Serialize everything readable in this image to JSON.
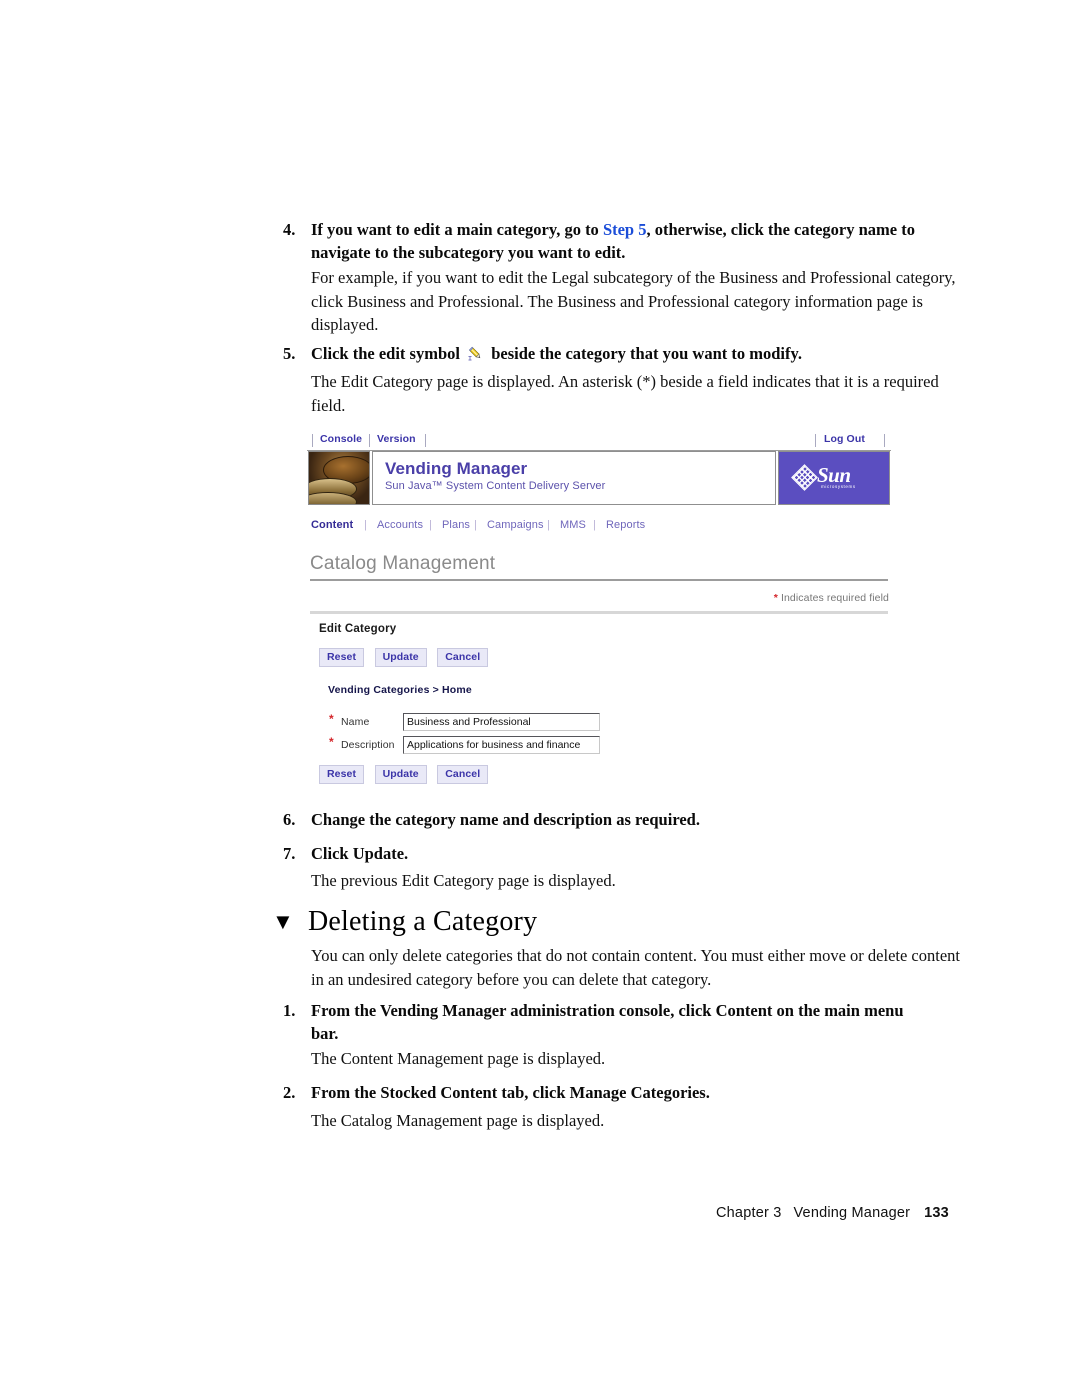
{
  "doc": {
    "steps": [
      {
        "number": "4.",
        "text_before": "If you want to edit a main category, go to ",
        "link": "Step 5",
        "text_after": ", otherwise, click the category name to navigate to the subcategory you want to edit."
      },
      {
        "number": "5.",
        "text_before": "Click the edit symbol ",
        "icon": "pencil-edit-icon",
        "text_after": " beside the category that you want to modify."
      },
      {
        "number": "6.",
        "text": "Change the category name and description as required."
      },
      {
        "number": "7.",
        "text": "Click Update."
      },
      {
        "number": "1.",
        "text": "From the Vending Manager administration console, click Content on the main menu bar."
      },
      {
        "number": "2.",
        "text": "From the Stocked Content tab, click Manage Categories."
      }
    ],
    "paragraphs": {
      "p_example": "For example, if you want to edit the Legal subcategory of the Business and Professional category, click Business and Professional. The Business and Professional category information page is displayed.",
      "p_edit_page": "The Edit Category page is displayed. An asterisk (*) beside a field indicates that it is a required field.",
      "p_previous": "The previous Edit Category page is displayed.",
      "p_delete_intro": "You can only delete categories that do not contain content. You must either move or delete content in an undesired category before you can delete that category.",
      "p_content_mgmt": "The Content Management page is displayed.",
      "p_catalog_mgmt": "The Catalog Management page is displayed."
    },
    "heading": {
      "marker": "▼",
      "title": "Deleting a Category"
    },
    "footer": {
      "chapter": "Chapter 3",
      "chapter_title": "Vending Manager",
      "page_number": "133"
    }
  },
  "screenshot": {
    "utility_bar": {
      "console": "Console",
      "version": "Version",
      "log_out": "Log Out"
    },
    "banner": {
      "app_title": "Vending Manager",
      "app_subtitle": "Sun Java™ System Content Delivery Server",
      "logo_word": "Sun",
      "logo_micro": "microsystems",
      "thumbnail": "coin-stack-photo"
    },
    "nav": {
      "items": [
        {
          "label": "Content",
          "active": true
        },
        {
          "label": "Accounts",
          "active": false
        },
        {
          "label": "Plans",
          "active": false
        },
        {
          "label": "Campaigns",
          "active": false
        },
        {
          "label": "MMS",
          "active": false
        },
        {
          "label": "Reports",
          "active": false
        }
      ],
      "separator": "|"
    },
    "page_title": "Catalog Management",
    "required_note": {
      "asterisk": "*",
      "text": "Indicates required field"
    },
    "section_label": "Edit Category",
    "buttons": [
      {
        "label": "Reset"
      },
      {
        "label": "Update"
      },
      {
        "label": "Cancel"
      }
    ],
    "breadcrumb": {
      "root": "Vending Categories",
      "separator": ">",
      "current": "Home"
    },
    "fields": [
      {
        "required_mark": "*",
        "label": "Name",
        "value": "Business and Professional"
      },
      {
        "required_mark": "*",
        "label": "Description",
        "value": "Applications for business and finance"
      }
    ],
    "colors": {
      "accent_purple": "#5b4ec0",
      "link_blue": "#3b34a8",
      "required_red": "#d4262b",
      "button_bg": "#e9e9f7"
    }
  }
}
